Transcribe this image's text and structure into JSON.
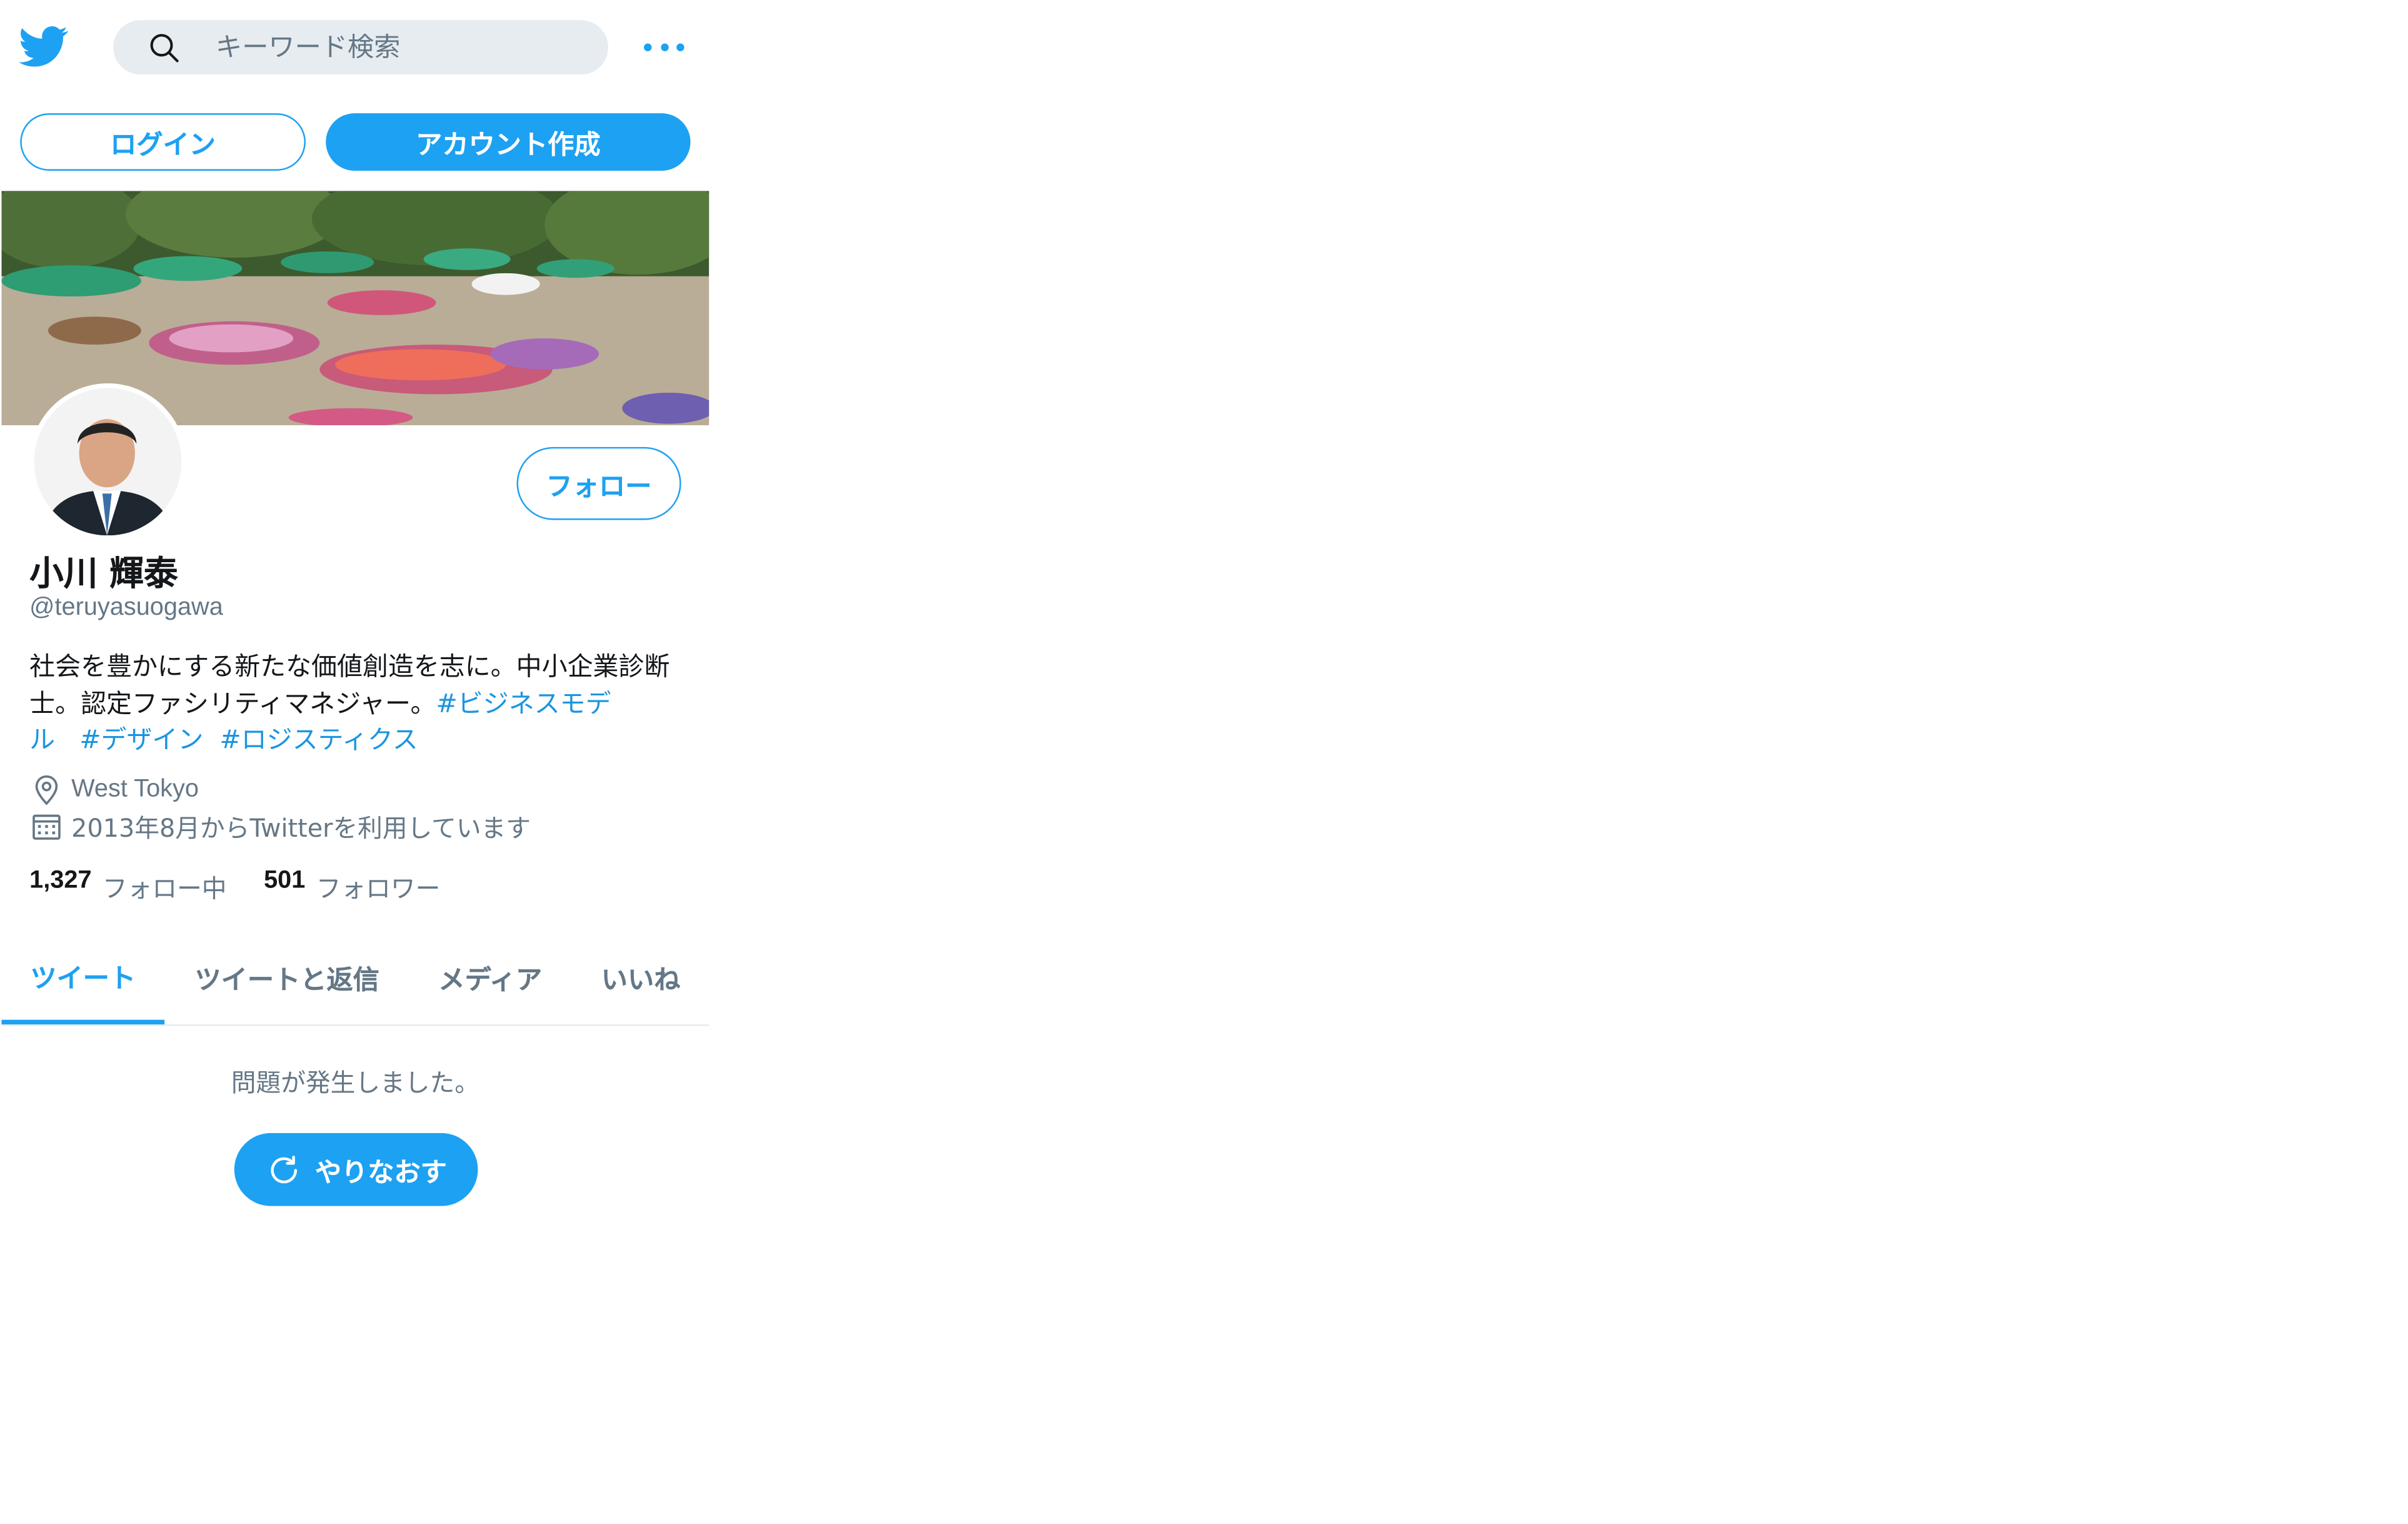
{
  "header": {
    "logo_icon": "twitter-bird-icon",
    "search": {
      "placeholder": "キーワード検索",
      "icon": "search-icon"
    },
    "more_icon": "more-dots-icon"
  },
  "auth": {
    "login_label": "ログイン",
    "signup_label": "アカウント作成"
  },
  "profile": {
    "name": "小川 輝泰",
    "handle": "@teruyasuogawa",
    "follow_label": "フォロー",
    "bio_text": "社会を豊かにする新たな価値創造を志に。中小企業診断士。認定ファシリティマネジャー。",
    "hashtags": [
      "#ビジネスモデル",
      "#デザイン",
      "#ロジスティクス"
    ],
    "location": "West Tokyo",
    "joined": "2013年8月からTwitterを利用しています",
    "following_count": "1,327",
    "following_label": "フォロー中",
    "followers_count": "501",
    "followers_label": "フォロワー"
  },
  "tabs": [
    {
      "label": "ツイート",
      "active": true
    },
    {
      "label": "ツイートと返信",
      "active": false
    },
    {
      "label": "メディア",
      "active": false
    },
    {
      "label": "いいね",
      "active": false
    }
  ],
  "error": {
    "message": "問題が発生しました。",
    "retry_label": "やりなおす",
    "retry_icon": "refresh-icon"
  },
  "colors": {
    "accent": "#1da1f2",
    "link": "#1b95e0",
    "secondary_text": "#657786",
    "primary_text": "#14171a",
    "search_bg": "#e6ecf0"
  }
}
